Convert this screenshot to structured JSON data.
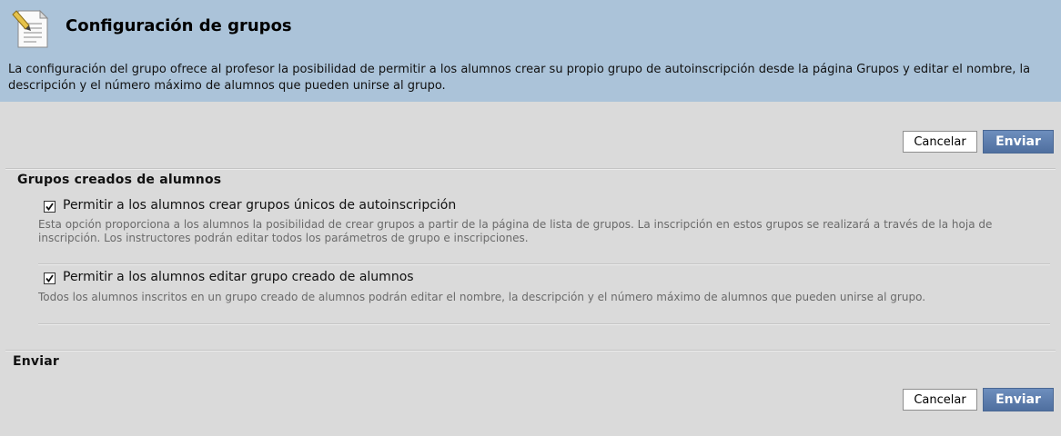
{
  "header": {
    "icon": "document-edit-icon",
    "title": "Configuración de grupos",
    "description": "La configuración del grupo ofrece al profesor la posibilidad de permitir a los alumnos crear su propio grupo de autoinscripción desde la página Grupos y editar el nombre, la descripción y el número máximo de alumnos que pueden unirse al grupo."
  },
  "top_actions": {
    "cancel_label": "Cancelar",
    "submit_label": "Enviar"
  },
  "section": {
    "title": "Grupos creados de alumnos",
    "options": [
      {
        "checked": true,
        "label": "Permitir a los alumnos crear grupos únicos de autoinscripción",
        "help": "Esta opción proporciona a los alumnos la posibilidad de crear grupos a partir de la página de lista de grupos. La inscripción en estos grupos se realizará a través de la hoja de inscripción. Los instructores podrán editar todos los parámetros de grupo e inscripciones."
      },
      {
        "checked": true,
        "label": "Permitir a los alumnos editar grupo creado de alumnos",
        "help": "Todos los alumnos inscritos en un grupo creado de alumnos podrán editar el nombre, la descripción y el número máximo de alumnos que pueden unirse al grupo."
      }
    ]
  },
  "submit_section": {
    "title": "Enviar"
  },
  "bottom_actions": {
    "cancel_label": "Cancelar",
    "submit_label": "Enviar"
  },
  "colors": {
    "header_bg": "#abc3d9",
    "page_bg": "#dadada",
    "primary_button": "#5b7db0"
  }
}
